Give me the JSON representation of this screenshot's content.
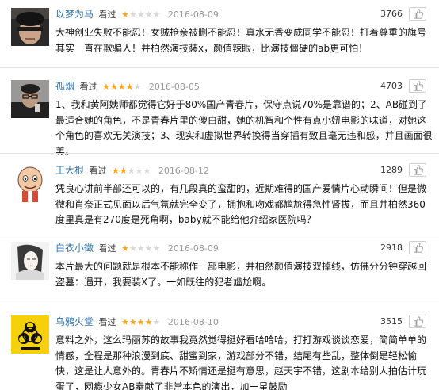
{
  "reviews": [
    {
      "username": "以梦为马",
      "status": "看过",
      "rating": 1,
      "date": "2016-08-09",
      "votes": "3766",
      "avatar": "avatar-photo-dark-face",
      "comment": "大神创业失败不能忍！女贼抢亲被删不能忍！真水无香变成同学不能忍！打着尊重的旗号其实一直在欺骗人！井柏然演技装x，颜值辣眼，比演技僵硬的ab更可怕！"
    },
    {
      "username": "孤烟",
      "status": "看过",
      "rating": 4,
      "date": "2016-08-05",
      "votes": "4703",
      "avatar": "avatar-photo-man-glasses",
      "comment": "1、我和黄阿姨师都觉得它好于80%国产青春片，保守点说70%是靠谱的；2、AB碰到了最适合她的角色，不是青春片里的傻白甜，她的机智和个性有点小妞电影的味道，对她这个角色的喜欢无关演技；3、现实和虚拟世界转换得当穿插有致且毫无违和感，并且画面很美。"
    },
    {
      "username": "王大根",
      "status": "看过",
      "rating": 2,
      "date": "2016-08-12",
      "votes": "1289",
      "avatar": "avatar-cartoon-bald-man",
      "comment": "凭良心讲前半部还可以的，有几段真的蛮甜的，近期难得的国产爱情片心动瞬间！但是微微和肖奈正式见面以后气氛就完全变了，拥抱和吻戏都尴尬得急性肾拔，而且井柏然360度里真是有270度是死角啊，baby就不能给他介绍家医院吗？"
    },
    {
      "username": "白衣小徵",
      "status": "看过",
      "rating": 1,
      "date": "2016-08-09",
      "votes": "2918",
      "avatar": "avatar-illustration-ink-portrait",
      "comment": "本片最大的问题就是根本不能称作一部电影，井柏然颜值演技双掉线，仿佛分分钟穿越回盗墓：遇开，我要装X了。一如既往的犯者尴尬啊。"
    },
    {
      "username": "乌鸦火堂",
      "status": "看过",
      "rating": 4,
      "date": "2016-08-10",
      "votes": "3515",
      "avatar": "avatar-biohazard-symbol",
      "comment": "意料之外，这么玛丽苏的故事我竟然觉得挺好看哈哈哈，打打游戏谈谈恋爱，简简单单的情感，全程是那种浪漫到底、甜蜜到家，游戏部分不错，结尾有些乱，整体倒是轻松愉快，这是让人意外的。青春片不矫情还是挺有意思，赵天宇不错，这剧本给别人拍估计玩蛋了，网瘾少女AB奉献了非常本色的演出，加一星鼓励"
    }
  ],
  "icons": {
    "vote": "thumbs-up-icon",
    "star_filled": "★",
    "star_empty": "★"
  },
  "colors": {
    "username": "#3377aa",
    "star_on": "#f8a51d",
    "star_off": "#d8d8d8",
    "date": "#999999",
    "divider": "#e4e4e4"
  }
}
